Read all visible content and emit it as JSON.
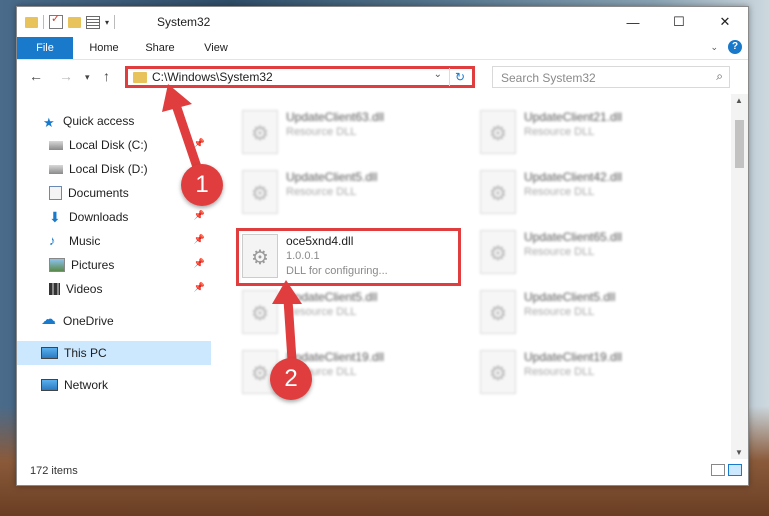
{
  "window": {
    "title": "System32"
  },
  "ribbon": {
    "tabs": [
      "File",
      "Home",
      "Share",
      "View"
    ]
  },
  "address": {
    "path": "C:\\Windows\\System32"
  },
  "search": {
    "placeholder": "Search System32"
  },
  "sidebar": {
    "items": [
      {
        "label": "Quick access",
        "icon": "star-icon",
        "pinned": false
      },
      {
        "label": "Local Disk (C:)",
        "icon": "drive-icon",
        "pinned": true
      },
      {
        "label": "Local Disk (D:)",
        "icon": "drive-icon",
        "pinned": false
      },
      {
        "label": "Documents",
        "icon": "documents-icon",
        "pinned": true
      },
      {
        "label": "Downloads",
        "icon": "download-icon",
        "pinned": true
      },
      {
        "label": "Music",
        "icon": "music-icon",
        "pinned": true
      },
      {
        "label": "Pictures",
        "icon": "pictures-icon",
        "pinned": true
      },
      {
        "label": "Videos",
        "icon": "videos-icon",
        "pinned": true
      },
      {
        "label": "OneDrive",
        "icon": "cloud-icon",
        "pinned": false
      },
      {
        "label": "This PC",
        "icon": "computer-icon",
        "pinned": false
      },
      {
        "label": "Network",
        "icon": "network-icon",
        "pinned": false
      }
    ]
  },
  "files": {
    "left": [
      {
        "name": "UpdateClient63.dll",
        "line1": "Resource DLL",
        "line2": ""
      },
      {
        "name": "UpdateClient5.dll",
        "line1": "Resource DLL",
        "line2": ""
      },
      {
        "name": "oce5xnd4.dll",
        "line1": "1.0.0.1",
        "line2": "DLL for configuring..."
      },
      {
        "name": "UpdateClient5.dll",
        "line1": "Resource DLL",
        "line2": ""
      },
      {
        "name": "UpdateClient19.dll",
        "line1": "Resource DLL",
        "line2": ""
      }
    ],
    "right": [
      {
        "name": "UpdateClient21.dll",
        "line1": "Resource DLL"
      },
      {
        "name": "UpdateClient42.dll",
        "line1": "Resource DLL"
      },
      {
        "name": "UpdateClient65.dll",
        "line1": "Resource DLL"
      },
      {
        "name": "UpdateClient5.dll",
        "line1": "Resource DLL"
      },
      {
        "name": "UpdateClient19.dll",
        "line1": "Resource DLL"
      }
    ]
  },
  "status": {
    "count": "172 items"
  },
  "annotations": {
    "step1": "1",
    "step2": "2"
  },
  "colors": {
    "accent": "#1979ca",
    "annotation": "#e03e3e",
    "selection": "#cce8ff"
  }
}
